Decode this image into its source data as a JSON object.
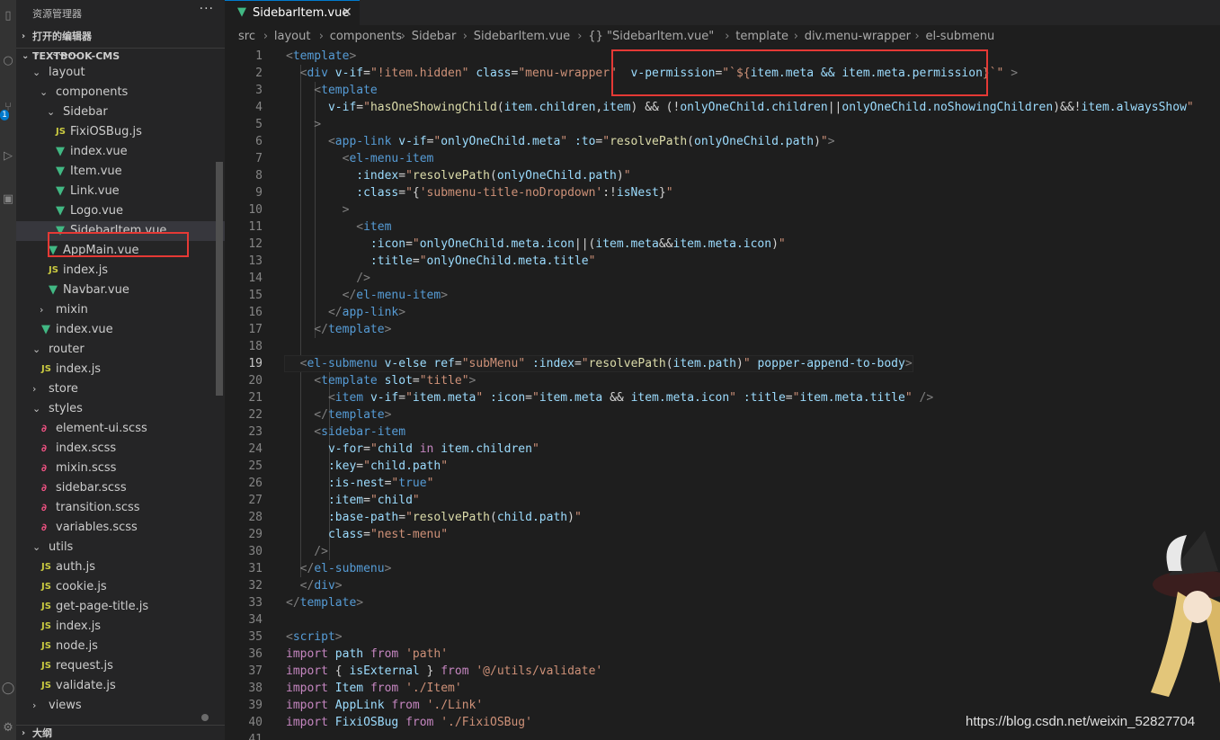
{
  "sidebar": {
    "title": "资源管理器",
    "more": "···",
    "open_editors": "打开的编辑器",
    "project": "TEXTBOOK-CMS",
    "outline": "大纲",
    "tree": [
      {
        "label": "icons",
        "indent": 1,
        "kind": "folder-open"
      },
      {
        "label": "layout",
        "indent": 1,
        "kind": "folder-open"
      },
      {
        "label": "components",
        "indent": 2,
        "kind": "folder-open"
      },
      {
        "label": "Sidebar",
        "indent": 3,
        "kind": "folder-open"
      },
      {
        "label": "FixiOSBug.js",
        "indent": 4,
        "kind": "js"
      },
      {
        "label": "index.vue",
        "indent": 4,
        "kind": "vue"
      },
      {
        "label": "Item.vue",
        "indent": 4,
        "kind": "vue"
      },
      {
        "label": "Link.vue",
        "indent": 4,
        "kind": "vue"
      },
      {
        "label": "Logo.vue",
        "indent": 4,
        "kind": "vue"
      },
      {
        "label": "SidebarItem.vue",
        "indent": 4,
        "kind": "vue",
        "active": true
      },
      {
        "label": "AppMain.vue",
        "indent": 3,
        "kind": "vue"
      },
      {
        "label": "index.js",
        "indent": 3,
        "kind": "js"
      },
      {
        "label": "Navbar.vue",
        "indent": 3,
        "kind": "vue"
      },
      {
        "label": "mixin",
        "indent": 2,
        "kind": "folder-closed"
      },
      {
        "label": "index.vue",
        "indent": 2,
        "kind": "vue"
      },
      {
        "label": "router",
        "indent": 1,
        "kind": "folder-open"
      },
      {
        "label": "index.js",
        "indent": 2,
        "kind": "js"
      },
      {
        "label": "store",
        "indent": 1,
        "kind": "folder-closed"
      },
      {
        "label": "styles",
        "indent": 1,
        "kind": "folder-open"
      },
      {
        "label": "element-ui.scss",
        "indent": 2,
        "kind": "scss"
      },
      {
        "label": "index.scss",
        "indent": 2,
        "kind": "scss"
      },
      {
        "label": "mixin.scss",
        "indent": 2,
        "kind": "scss"
      },
      {
        "label": "sidebar.scss",
        "indent": 2,
        "kind": "scss"
      },
      {
        "label": "transition.scss",
        "indent": 2,
        "kind": "scss"
      },
      {
        "label": "variables.scss",
        "indent": 2,
        "kind": "scss"
      },
      {
        "label": "utils",
        "indent": 1,
        "kind": "folder-open"
      },
      {
        "label": "auth.js",
        "indent": 2,
        "kind": "js"
      },
      {
        "label": "cookie.js",
        "indent": 2,
        "kind": "js"
      },
      {
        "label": "get-page-title.js",
        "indent": 2,
        "kind": "js"
      },
      {
        "label": "index.js",
        "indent": 2,
        "kind": "js"
      },
      {
        "label": "node.js",
        "indent": 2,
        "kind": "js"
      },
      {
        "label": "request.js",
        "indent": 2,
        "kind": "js"
      },
      {
        "label": "validate.js",
        "indent": 2,
        "kind": "js"
      },
      {
        "label": "views",
        "indent": 1,
        "kind": "folder-closed"
      }
    ],
    "icon_glyphs": {
      "js": "JS",
      "vue": "▼",
      "scss": "∂",
      "folder-open": "⌄",
      "folder-closed": "›"
    }
  },
  "activity": {
    "badge": "1"
  },
  "tab": {
    "label": "SidebarItem.vue",
    "close": "✕"
  },
  "breadcrumb": [
    "src",
    "layout",
    "components",
    "Sidebar",
    "SidebarItem.vue",
    "{} \"SidebarItem.vue\"",
    "template",
    "div.menu-wrapper",
    "el-submenu"
  ],
  "code": {
    "current_line": 19,
    "lines": [
      [
        [
          "t",
          "<"
        ],
        [
          "tn",
          "template"
        ],
        [
          "t",
          ">"
        ]
      ],
      [
        [
          "t",
          "  <"
        ],
        [
          "tn",
          "div"
        ],
        [
          "ws",
          " "
        ],
        [
          "an",
          "v-if"
        ],
        [
          "ws",
          "="
        ],
        [
          "av",
          "\"!item.hidden\""
        ],
        [
          "ws",
          " "
        ],
        [
          "an",
          "class"
        ],
        [
          "ws",
          "="
        ],
        [
          "av",
          "\"menu-wrapper\""
        ],
        [
          "ws",
          "  "
        ],
        [
          "an",
          "v-permission"
        ],
        [
          "ws",
          "="
        ],
        [
          "av",
          "\"`${"
        ],
        [
          "id",
          "item.meta && item.meta.permission"
        ],
        [
          "av",
          "}`\""
        ],
        [
          "ws",
          " "
        ],
        [
          "t",
          ">"
        ]
      ],
      [
        [
          "t",
          "    <"
        ],
        [
          "tn",
          "template"
        ]
      ],
      [
        [
          "ws",
          "      "
        ],
        [
          "an",
          "v-if"
        ],
        [
          "ws",
          "="
        ],
        [
          "av",
          "\""
        ],
        [
          "fn",
          "hasOneShowingChild"
        ],
        [
          "ws",
          "("
        ],
        [
          "id",
          "item.children"
        ],
        [
          "ws",
          ","
        ],
        [
          "id",
          "item"
        ],
        [
          "ws",
          ") && (!"
        ],
        [
          "id",
          "onlyOneChild.children"
        ],
        [
          "ws",
          "||"
        ],
        [
          "id",
          "onlyOneChild.noShowingChildren"
        ],
        [
          "ws",
          ")&&!"
        ],
        [
          "id",
          "item.alwaysShow"
        ],
        [
          "av",
          "\""
        ]
      ],
      [
        [
          "t",
          "    >"
        ]
      ],
      [
        [
          "t",
          "      <"
        ],
        [
          "tn",
          "app-link"
        ],
        [
          "ws",
          " "
        ],
        [
          "an",
          "v-if"
        ],
        [
          "ws",
          "="
        ],
        [
          "av",
          "\""
        ],
        [
          "id",
          "onlyOneChild.meta"
        ],
        [
          "av",
          "\""
        ],
        [
          "ws",
          " "
        ],
        [
          "an",
          ":to"
        ],
        [
          "ws",
          "="
        ],
        [
          "av",
          "\""
        ],
        [
          "fn",
          "resolvePath"
        ],
        [
          "ws",
          "("
        ],
        [
          "id",
          "onlyOneChild.path"
        ],
        [
          "ws",
          ")"
        ],
        [
          "av",
          "\""
        ],
        [
          "t",
          ">"
        ]
      ],
      [
        [
          "t",
          "        <"
        ],
        [
          "tn",
          "el-menu-item"
        ]
      ],
      [
        [
          "ws",
          "          "
        ],
        [
          "an",
          ":index"
        ],
        [
          "ws",
          "="
        ],
        [
          "av",
          "\""
        ],
        [
          "fn",
          "resolvePath"
        ],
        [
          "ws",
          "("
        ],
        [
          "id",
          "onlyOneChild.path"
        ],
        [
          "ws",
          ")"
        ],
        [
          "av",
          "\""
        ]
      ],
      [
        [
          "ws",
          "          "
        ],
        [
          "an",
          ":class"
        ],
        [
          "ws",
          "="
        ],
        [
          "av",
          "\""
        ],
        [
          "ws",
          "{"
        ],
        [
          "av",
          "'submenu-title-noDropdown'"
        ],
        [
          "ws",
          ":!"
        ],
        [
          "id",
          "isNest"
        ],
        [
          "ws",
          "}"
        ],
        [
          "av",
          "\""
        ]
      ],
      [
        [
          "t",
          "        >"
        ]
      ],
      [
        [
          "t",
          "          <"
        ],
        [
          "tn",
          "item"
        ]
      ],
      [
        [
          "ws",
          "            "
        ],
        [
          "an",
          ":icon"
        ],
        [
          "ws",
          "="
        ],
        [
          "av",
          "\""
        ],
        [
          "id",
          "onlyOneChild.meta.icon"
        ],
        [
          "ws",
          "||("
        ],
        [
          "id",
          "item.meta"
        ],
        [
          "ws",
          "&&"
        ],
        [
          "id",
          "item.meta.icon"
        ],
        [
          "ws",
          ")"
        ],
        [
          "av",
          "\""
        ]
      ],
      [
        [
          "ws",
          "            "
        ],
        [
          "an",
          ":title"
        ],
        [
          "ws",
          "="
        ],
        [
          "av",
          "\""
        ],
        [
          "id",
          "onlyOneChild.meta.title"
        ],
        [
          "av",
          "\""
        ]
      ],
      [
        [
          "t",
          "          />"
        ]
      ],
      [
        [
          "t",
          "        </"
        ],
        [
          "tn",
          "el-menu-item"
        ],
        [
          "t",
          ">"
        ]
      ],
      [
        [
          "t",
          "      </"
        ],
        [
          "tn",
          "app-link"
        ],
        [
          "t",
          ">"
        ]
      ],
      [
        [
          "t",
          "    </"
        ],
        [
          "tn",
          "template"
        ],
        [
          "t",
          ">"
        ]
      ],
      [],
      [
        [
          "t",
          "  <"
        ],
        [
          "tn",
          "el-submenu"
        ],
        [
          "ws",
          " "
        ],
        [
          "an",
          "v-else"
        ],
        [
          "ws",
          " "
        ],
        [
          "an",
          "ref"
        ],
        [
          "ws",
          "="
        ],
        [
          "av",
          "\"subMenu\""
        ],
        [
          "ws",
          " "
        ],
        [
          "an",
          ":index"
        ],
        [
          "ws",
          "="
        ],
        [
          "av",
          "\""
        ],
        [
          "fn",
          "resolvePath"
        ],
        [
          "ws",
          "("
        ],
        [
          "id",
          "item.path"
        ],
        [
          "ws",
          ")"
        ],
        [
          "av",
          "\""
        ],
        [
          "ws",
          " "
        ],
        [
          "an",
          "popper-append-to-body"
        ],
        [
          "t",
          ">"
        ]
      ],
      [
        [
          "t",
          "    <"
        ],
        [
          "tn",
          "template"
        ],
        [
          "ws",
          " "
        ],
        [
          "an",
          "slot"
        ],
        [
          "ws",
          "="
        ],
        [
          "av",
          "\"title\""
        ],
        [
          "t",
          ">"
        ]
      ],
      [
        [
          "t",
          "      <"
        ],
        [
          "tn",
          "item"
        ],
        [
          "ws",
          " "
        ],
        [
          "an",
          "v-if"
        ],
        [
          "ws",
          "="
        ],
        [
          "av",
          "\""
        ],
        [
          "id",
          "item.meta"
        ],
        [
          "av",
          "\""
        ],
        [
          "ws",
          " "
        ],
        [
          "an",
          ":icon"
        ],
        [
          "ws",
          "="
        ],
        [
          "av",
          "\""
        ],
        [
          "id",
          "item.meta"
        ],
        [
          "ws",
          " && "
        ],
        [
          "id",
          "item.meta.icon"
        ],
        [
          "av",
          "\""
        ],
        [
          "ws",
          " "
        ],
        [
          "an",
          ":title"
        ],
        [
          "ws",
          "="
        ],
        [
          "av",
          "\""
        ],
        [
          "id",
          "item.meta.title"
        ],
        [
          "av",
          "\""
        ],
        [
          "ws",
          " "
        ],
        [
          "t",
          "/>"
        ]
      ],
      [
        [
          "t",
          "    </"
        ],
        [
          "tn",
          "template"
        ],
        [
          "t",
          ">"
        ]
      ],
      [
        [
          "t",
          "    <"
        ],
        [
          "tn",
          "sidebar-item"
        ]
      ],
      [
        [
          "ws",
          "      "
        ],
        [
          "an",
          "v-for"
        ],
        [
          "ws",
          "="
        ],
        [
          "av",
          "\""
        ],
        [
          "id",
          "child"
        ],
        [
          "ws",
          " "
        ],
        [
          "kw",
          "in"
        ],
        [
          "ws",
          " "
        ],
        [
          "id",
          "item.children"
        ],
        [
          "av",
          "\""
        ]
      ],
      [
        [
          "ws",
          "      "
        ],
        [
          "an",
          ":key"
        ],
        [
          "ws",
          "="
        ],
        [
          "av",
          "\""
        ],
        [
          "id",
          "child.path"
        ],
        [
          "av",
          "\""
        ]
      ],
      [
        [
          "ws",
          "      "
        ],
        [
          "an",
          ":is-nest"
        ],
        [
          "ws",
          "="
        ],
        [
          "av",
          "\""
        ],
        [
          "sc",
          "true"
        ],
        [
          "av",
          "\""
        ]
      ],
      [
        [
          "ws",
          "      "
        ],
        [
          "an",
          ":item"
        ],
        [
          "ws",
          "="
        ],
        [
          "av",
          "\""
        ],
        [
          "id",
          "child"
        ],
        [
          "av",
          "\""
        ]
      ],
      [
        [
          "ws",
          "      "
        ],
        [
          "an",
          ":base-path"
        ],
        [
          "ws",
          "="
        ],
        [
          "av",
          "\""
        ],
        [
          "fn",
          "resolvePath"
        ],
        [
          "ws",
          "("
        ],
        [
          "id",
          "child.path"
        ],
        [
          "ws",
          ")"
        ],
        [
          "av",
          "\""
        ]
      ],
      [
        [
          "ws",
          "      "
        ],
        [
          "an",
          "class"
        ],
        [
          "ws",
          "="
        ],
        [
          "av",
          "\"nest-menu\""
        ]
      ],
      [
        [
          "t",
          "    />"
        ]
      ],
      [
        [
          "t",
          "  </"
        ],
        [
          "tn",
          "el-submenu"
        ],
        [
          "t",
          ">"
        ]
      ],
      [
        [
          "t",
          "  </"
        ],
        [
          "tn",
          "div"
        ],
        [
          "t",
          ">"
        ]
      ],
      [
        [
          "t",
          "</"
        ],
        [
          "tn",
          "template"
        ],
        [
          "t",
          ">"
        ]
      ],
      [],
      [
        [
          "t",
          "<"
        ],
        [
          "tn",
          "script"
        ],
        [
          "t",
          ">"
        ]
      ],
      [
        [
          "kw",
          "import"
        ],
        [
          "ws",
          " "
        ],
        [
          "id",
          "path"
        ],
        [
          "ws",
          " "
        ],
        [
          "kw",
          "from"
        ],
        [
          "ws",
          " "
        ],
        [
          "av",
          "'path'"
        ]
      ],
      [
        [
          "kw",
          "import"
        ],
        [
          "ws",
          " { "
        ],
        [
          "id",
          "isExternal"
        ],
        [
          "ws",
          " } "
        ],
        [
          "kw",
          "from"
        ],
        [
          "ws",
          " "
        ],
        [
          "av",
          "'@/utils/validate'"
        ]
      ],
      [
        [
          "kw",
          "import"
        ],
        [
          "ws",
          " "
        ],
        [
          "id",
          "Item"
        ],
        [
          "ws",
          " "
        ],
        [
          "kw",
          "from"
        ],
        [
          "ws",
          " "
        ],
        [
          "av",
          "'./Item'"
        ]
      ],
      [
        [
          "kw",
          "import"
        ],
        [
          "ws",
          " "
        ],
        [
          "id",
          "AppLink"
        ],
        [
          "ws",
          " "
        ],
        [
          "kw",
          "from"
        ],
        [
          "ws",
          " "
        ],
        [
          "av",
          "'./Link'"
        ]
      ],
      [
        [
          "kw",
          "import"
        ],
        [
          "ws",
          " "
        ],
        [
          "id",
          "FixiOSBug"
        ],
        [
          "ws",
          " "
        ],
        [
          "kw",
          "from"
        ],
        [
          "ws",
          " "
        ],
        [
          "av",
          "'./FixiOSBug'"
        ]
      ],
      []
    ]
  },
  "watermark": "https://blog.csdn.net/weixin_52827704"
}
